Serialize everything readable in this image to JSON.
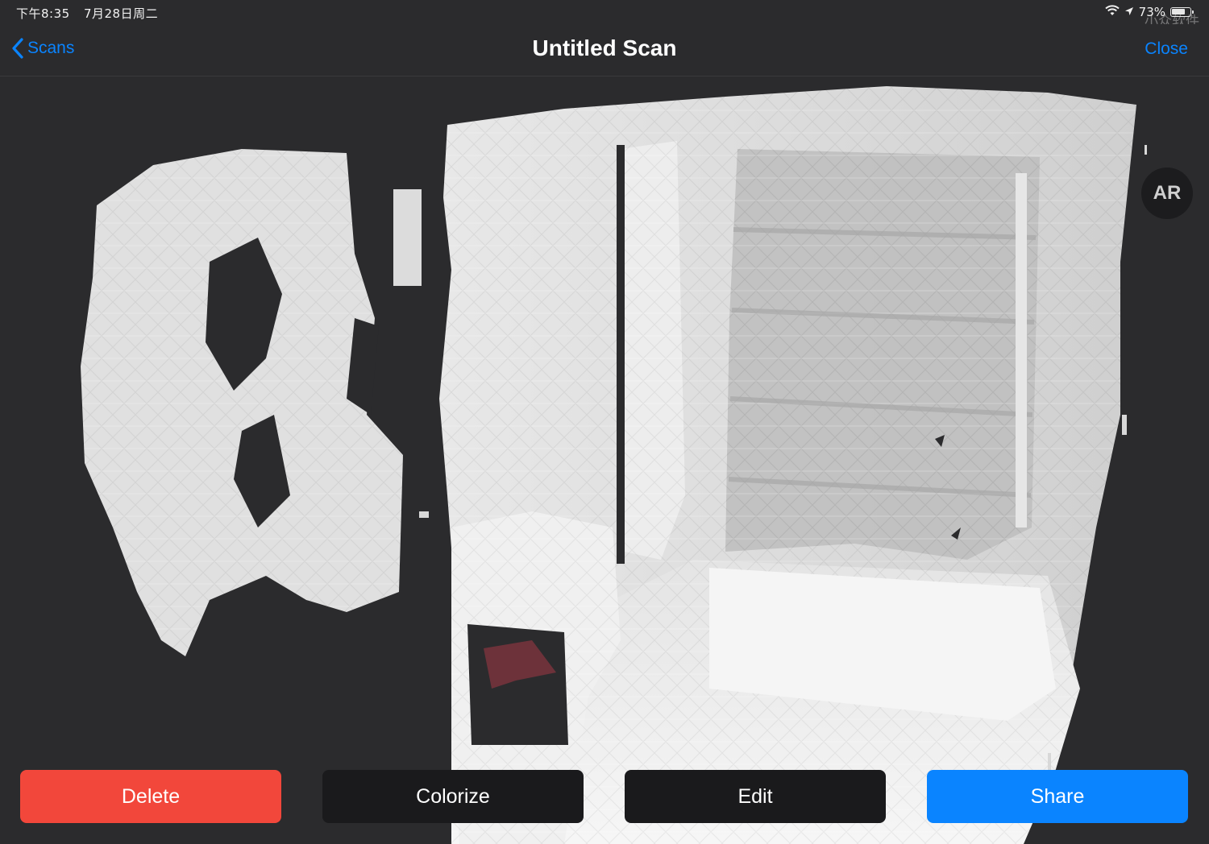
{
  "status_bar": {
    "time": "下午8:35",
    "date": "7月28日周二",
    "battery_percent": "73%",
    "icons": [
      "wifi-icon",
      "location-arrow-icon",
      "battery-icon"
    ],
    "watermark": "小众软件"
  },
  "nav": {
    "back_label": "Scans",
    "title": "Untitled Scan",
    "close_label": "Close"
  },
  "viewport": {
    "ar_label": "AR"
  },
  "toolbar": {
    "delete_label": "Delete",
    "colorize_label": "Colorize",
    "edit_label": "Edit",
    "share_label": "Share"
  },
  "colors": {
    "accent": "#0a84ff",
    "destructive": "#f2473b",
    "background": "#2b2b2d",
    "dark_button": "#1a1a1c"
  }
}
